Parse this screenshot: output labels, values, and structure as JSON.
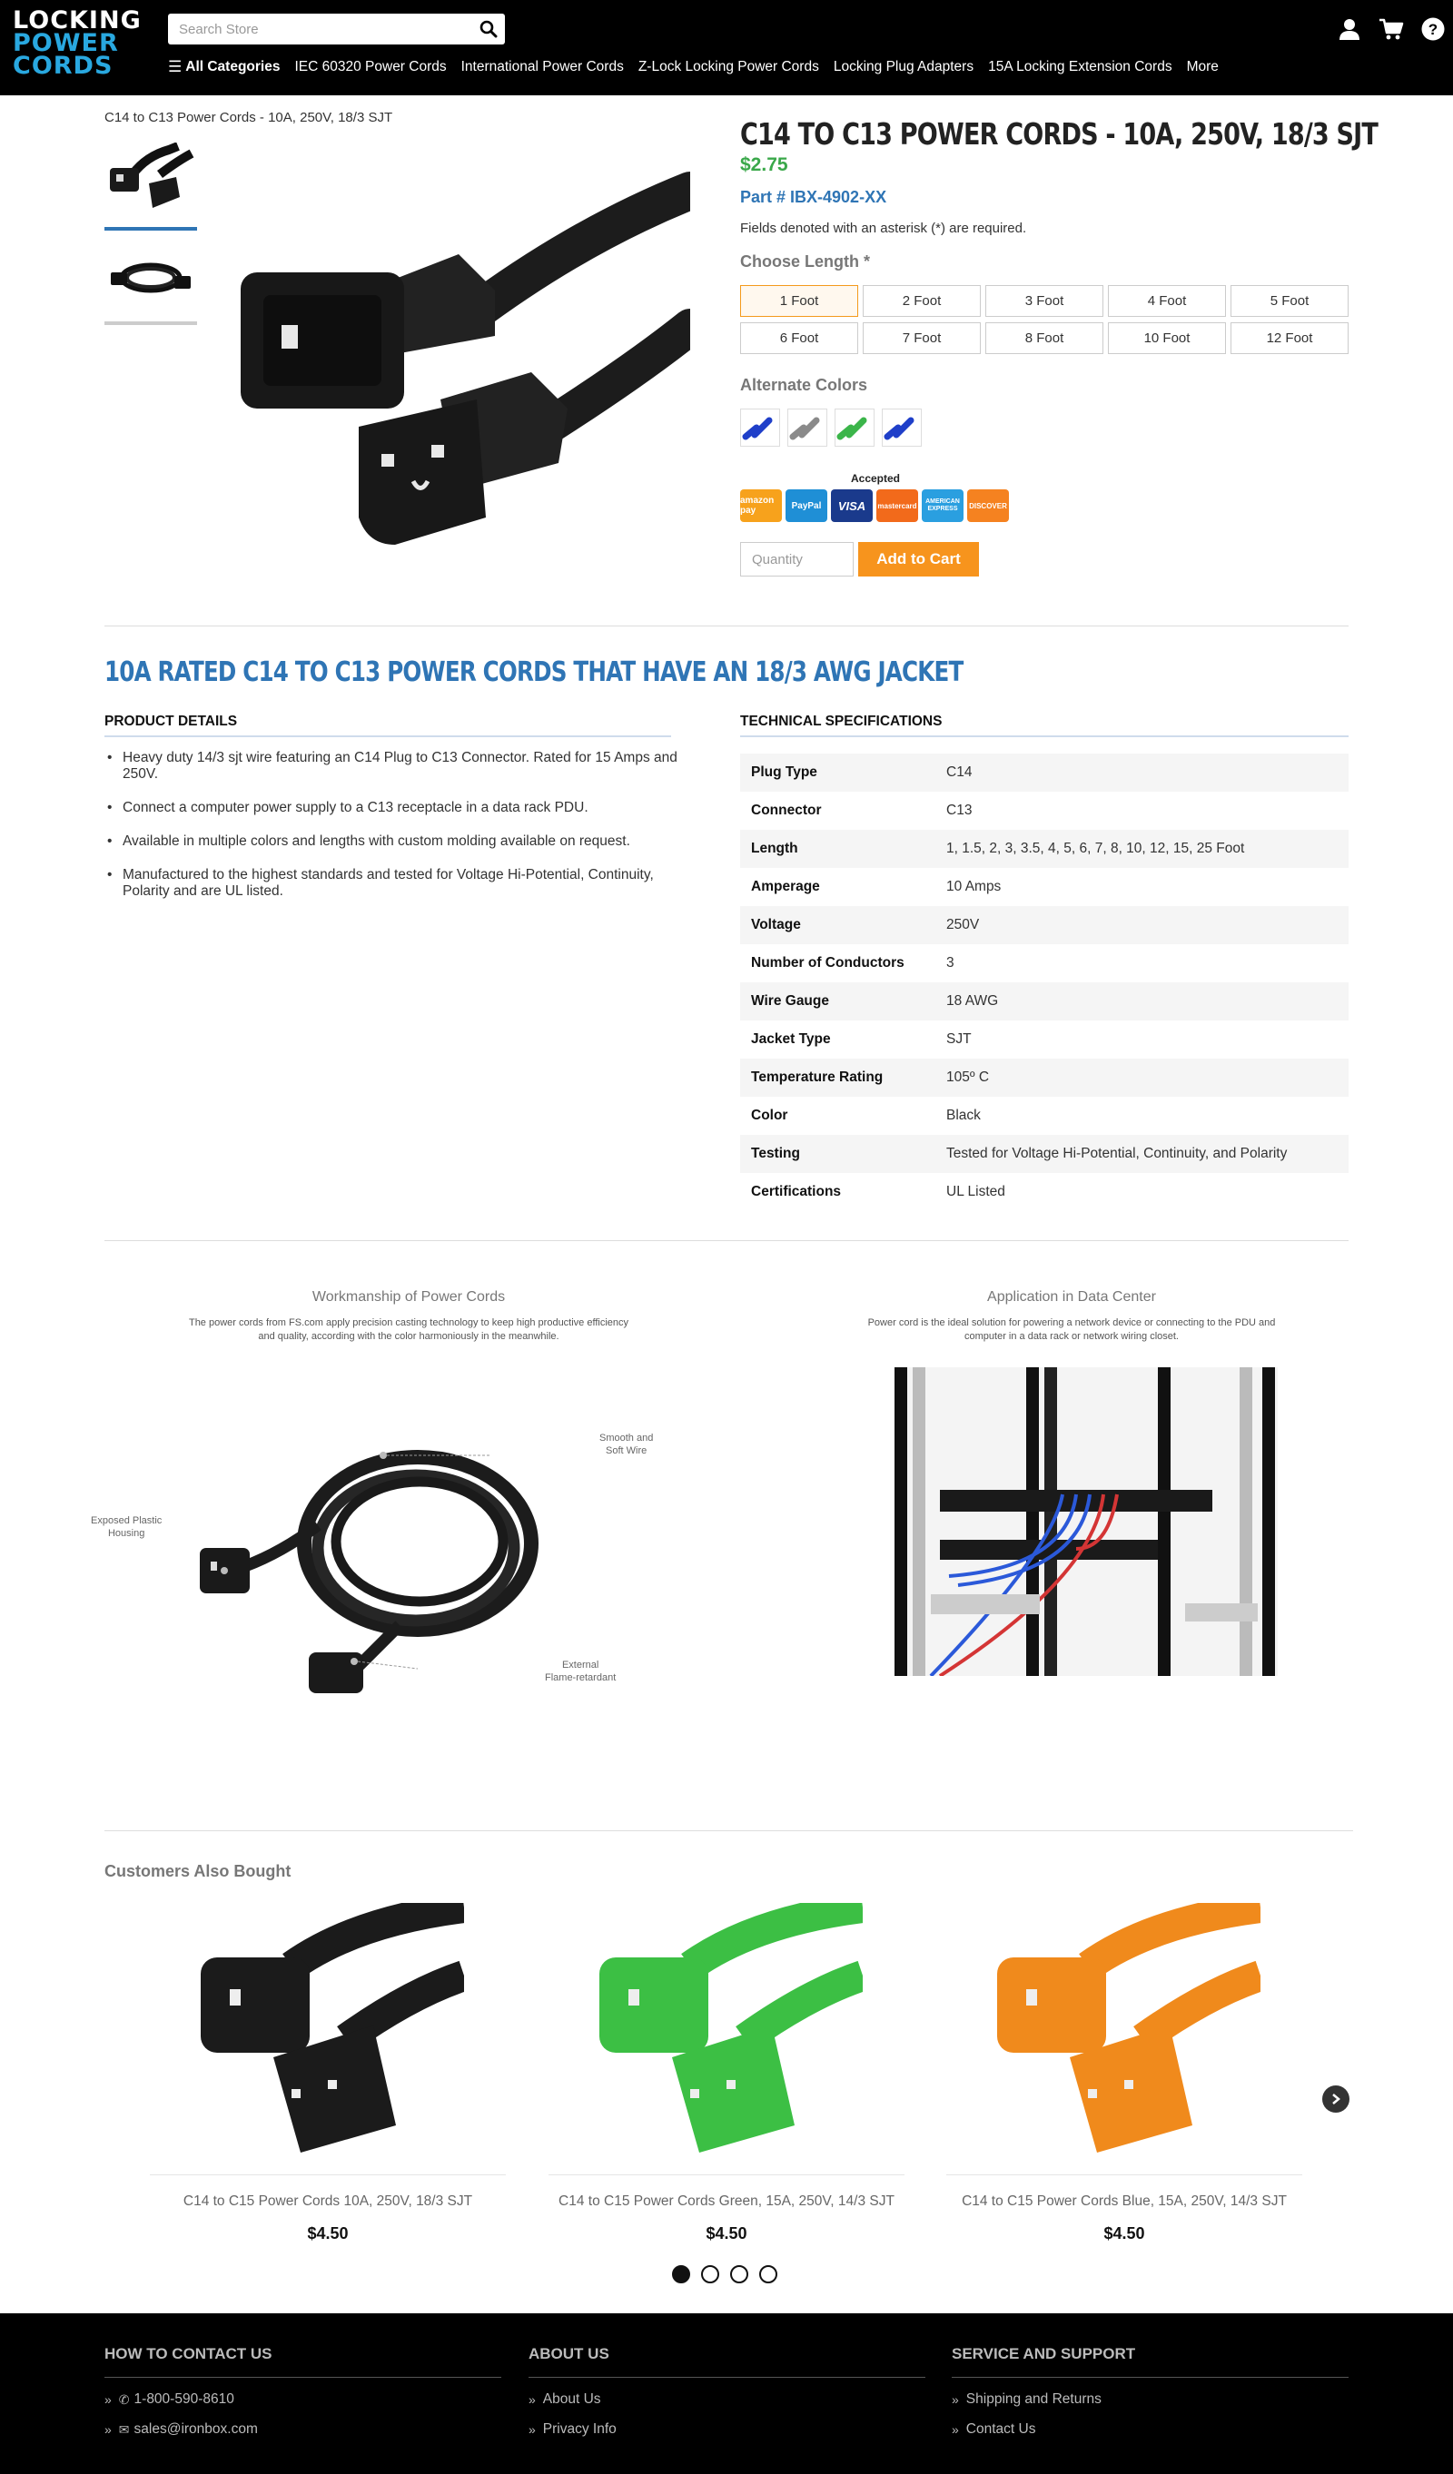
{
  "header": {
    "logo": [
      "LOCKING",
      "POWER",
      "CORDS"
    ],
    "search_placeholder": "Search Store",
    "nav": [
      "All Categories",
      "IEC 60320 Power Cords",
      "International Power Cords",
      "Z-Lock Locking Power Cords",
      "Locking Plug Adapters",
      "15A Locking Extension Cords",
      "More"
    ],
    "icons": [
      "user-icon",
      "cart-icon",
      "help-icon"
    ]
  },
  "breadcrumb": "C14 to C13 Power Cords - 10A, 250V, 18/3 SJT",
  "product": {
    "title": "C14 TO C13 POWER CORDS - 10A, 250V, 18/3 SJT",
    "price": "$2.75",
    "part_number": "Part # IBX-4902-XX",
    "fields_note": "Fields denoted with an asterisk (*) are required.",
    "choose_length_label": "Choose Length *",
    "lengths": [
      "1 Foot",
      "2 Foot",
      "3 Foot",
      "4 Foot",
      "5 Foot",
      "6 Foot",
      "7 Foot",
      "8 Foot",
      "10 Foot",
      "12 Foot"
    ],
    "selected_length": "1 Foot",
    "alternate_colors_label": "Alternate Colors",
    "alternate_colors": [
      "#1f3fc9",
      "#8a8a8a",
      "#3bb54a",
      "#1f3fc9"
    ],
    "accepted_label": "Accepted",
    "payment_methods": [
      "amazon pay",
      "PayPal",
      "VISA",
      "mastercard",
      "AMERICAN EXPRESS",
      "DISCOVER"
    ],
    "quantity_placeholder": "Quantity",
    "add_to_cart": "Add to Cart"
  },
  "details": {
    "heading": "10A RATED C14 TO C13 POWER CORDS THAT HAVE AN 18/3 AWG JACKET",
    "product_details_label": "PRODUCT DETAILS",
    "bullets": [
      "Heavy duty 14/3 sjt wire featuring an C14 Plug to C13 Connector. Rated for 15 Amps and 250V.",
      "Connect a computer power supply to a C13 receptacle in a data rack PDU.",
      "Available in multiple colors and lengths with custom molding available on request.",
      "Manufactured to the highest standards and tested for Voltage Hi-Potential, Continuity, Polarity and are UL listed."
    ],
    "tech_specs_label": "TECHNICAL SPECIFICATIONS",
    "specs": [
      [
        "Plug Type",
        "C14"
      ],
      [
        "Connector",
        "C13"
      ],
      [
        "Length",
        "1, 1.5, 2, 3, 3.5, 4, 5, 6, 7, 8, 10, 12, 15, 25 Foot"
      ],
      [
        "Amperage",
        "10 Amps"
      ],
      [
        "Voltage",
        "250V"
      ],
      [
        "Number of Conductors",
        "3"
      ],
      [
        "Wire Gauge",
        "18 AWG"
      ],
      [
        "Jacket Type",
        "SJT"
      ],
      [
        "Temperature Rating",
        "105º C"
      ],
      [
        "Color",
        "Black"
      ],
      [
        "Testing",
        "Tested for Voltage Hi-Potential, Continuity, and Polarity"
      ],
      [
        "Certifications",
        "UL Listed"
      ]
    ]
  },
  "features": {
    "left_title": "Workmanship of Power Cords",
    "left_desc_1": "The power cords from FS.com apply precision casting technology to keep high productive efficiency",
    "left_desc_2": "and quality, according with the color harmoniously in the meanwhile.",
    "callout_smooth_1": "Smooth and",
    "callout_smooth_2": "Soft Wire",
    "callout_exposed_1": "Exposed Plastic",
    "callout_exposed_2": "Housing",
    "callout_external_1": "External",
    "callout_external_2": "Flame-retardant",
    "right_title": "Application in Data Center",
    "right_desc_1": "Power cord is the ideal solution for powering a network device or connecting to the PDU and",
    "right_desc_2": "computer in a data rack or network wiring closet."
  },
  "customers_also_bought": {
    "label": "Customers Also Bought",
    "items": [
      {
        "name": "C14 to C15 Power Cords 10A, 250V, 18/3 SJT",
        "price": "$4.50",
        "color": "#1b1b1b"
      },
      {
        "name": "C14 to C15 Power Cords Green, 15A, 250V, 14/3 SJT",
        "price": "$4.50",
        "color": "#3cbf44"
      },
      {
        "name": "C14 to C15 Power Cords Blue, 15A, 250V, 14/3 SJT",
        "price": "$4.50",
        "color": "#f08a1c"
      }
    ],
    "carousel_dots": 4,
    "active_dot": 0
  },
  "footer": {
    "contact_heading": "HOW TO CONTACT US",
    "phone": "1-800-590-8610",
    "email": "sales@ironbox.com",
    "about_heading": "ABOUT US",
    "about_links": [
      "About Us",
      "Privacy Info"
    ],
    "service_heading": "SERVICE AND SUPPORT",
    "service_links": [
      "Shipping and Returns",
      "Contact Us"
    ]
  },
  "colors": {
    "accent_blue": "#2f75b5",
    "price_green": "#3aa84a",
    "cart_orange": "#f7941d",
    "logo_blue": "#29a8e0"
  }
}
